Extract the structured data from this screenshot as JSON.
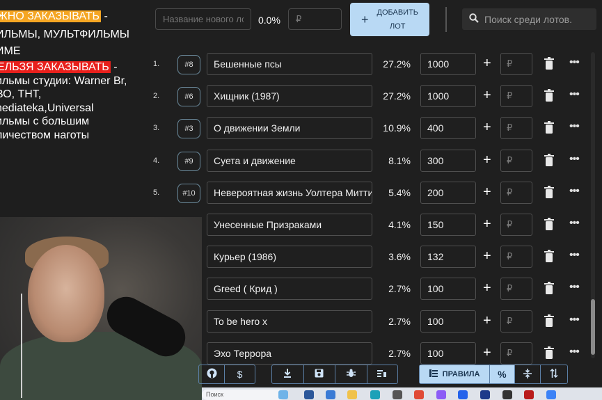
{
  "notes": {
    "line1_hl": "ЖНО ЗАКАЗЫВАТЬ",
    "line1_rest": " -",
    "line2": "ИЛЬМЫ, МУЛЬТФИЛЬМЫ",
    "line3": "ИМЕ",
    "line4_hl": "ЕЛЬЗЯ ЗАКАЗЫВАТЬ",
    "line4_rest": " -",
    "line5": "ильмы студии: Warner Br,",
    "line6": "ВО, ТНТ,",
    "line7": "nediateka,Universal",
    "line8": "ильмы с большим",
    "line9": "личеством наготы"
  },
  "topbar": {
    "new_lot_placeholder": "Название нового лота",
    "percent": "0.0%",
    "amount_placeholder": "₽",
    "add_button_line1": "ДОБАВИТЬ",
    "add_button_line2": "ЛОТ",
    "add_icon": "+",
    "search_placeholder": "Поиск среди лотов."
  },
  "lots": [
    {
      "num": "1.",
      "tag": "#8",
      "title": "Бешенные псы",
      "percent": "27.2%",
      "amount": "1000"
    },
    {
      "num": "2.",
      "tag": "#6",
      "title": "Хищник (1987)",
      "percent": "27.2%",
      "amount": "1000"
    },
    {
      "num": "3.",
      "tag": "#3",
      "title": "О движении Земли",
      "percent": "10.9%",
      "amount": "400"
    },
    {
      "num": "4.",
      "tag": "#9",
      "title": "Суета и движение",
      "percent": "8.1%",
      "amount": "300"
    },
    {
      "num": "5.",
      "tag": "#10",
      "title": "Невероятная жизнь Уолтера Митти",
      "percent": "5.4%",
      "amount": "200"
    },
    {
      "num": "",
      "tag": "",
      "title": "Унесенные Призраками",
      "percent": "4.1%",
      "amount": "150"
    },
    {
      "num": "",
      "tag": "",
      "title": "Курьер (1986)",
      "percent": "3.6%",
      "amount": "132"
    },
    {
      "num": "",
      "tag": "",
      "title": "Greed ( Крид )",
      "percent": "2.7%",
      "amount": "100"
    },
    {
      "num": "",
      "tag": "",
      "title": "To be hero x",
      "percent": "2.7%",
      "amount": "100"
    },
    {
      "num": "",
      "tag": "",
      "title": "Эхо Террора",
      "percent": "2.7%",
      "amount": "100"
    }
  ],
  "row_labels": {
    "add_plus": "+",
    "add_placeholder": "₽",
    "more": "•••"
  },
  "bottombar": {
    "dollar": "$",
    "rules_label": "ПРАВИЛА",
    "percent_symbol": "%"
  },
  "taskbar": {
    "search_text": "Поиск"
  },
  "colors": {
    "accent": "#b9d9f4",
    "orange_highlight": "#f5a623",
    "red_highlight": "#e8201c",
    "background": "#1f1f1f"
  }
}
